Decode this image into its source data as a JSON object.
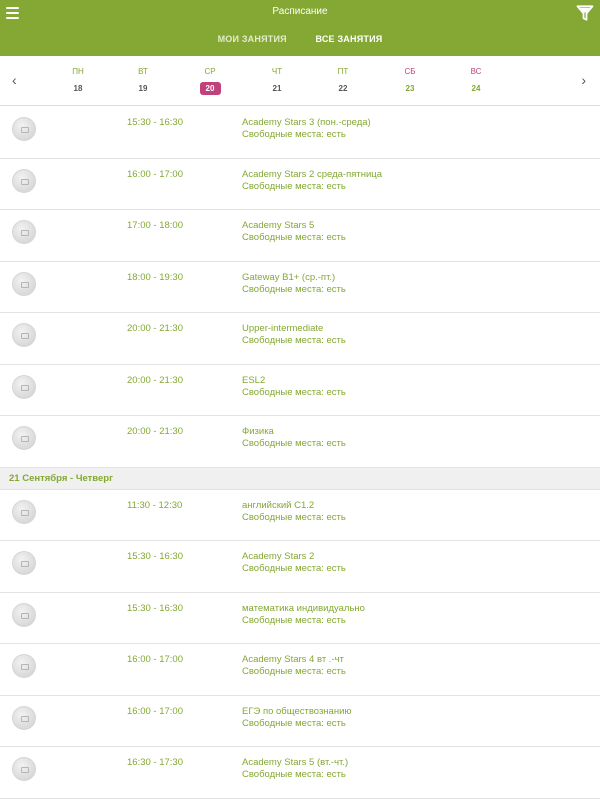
{
  "header": {
    "title": "Расписание",
    "tabs": [
      {
        "label": "МОИ ЗАНЯТИЯ",
        "active": false
      },
      {
        "label": "ВСЕ ЗАНЯТИЯ",
        "active": true
      }
    ],
    "menu_icon": "hamburger-icon",
    "filter_icon": "filter-icon"
  },
  "colors": {
    "accent": "#84a833",
    "highlight": "#c0427c"
  },
  "week": {
    "prev_icon": "chevron-left-icon",
    "next_icon": "chevron-right-icon",
    "days": [
      {
        "name": "ПН",
        "num": "18"
      },
      {
        "name": "ВТ",
        "num": "19"
      },
      {
        "name": "СР",
        "num": "20"
      },
      {
        "name": "ЧТ",
        "num": "21"
      },
      {
        "name": "ПТ",
        "num": "22"
      },
      {
        "name": "СБ",
        "num": "23"
      },
      {
        "name": "ВС",
        "num": "24"
      }
    ],
    "selected_day": "20"
  },
  "schedule": {
    "day_header": "21 Сентября - Четверг",
    "seats_label": "Свободные места: есть",
    "rows": [
      {
        "time": "15:30 - 16:30",
        "name": "Academy Stars 3 (пон.-среда)",
        "seats": "Свободные места: есть"
      },
      {
        "time": "16:00 - 17:00",
        "name": "Academy Stars 2 среда-пятница",
        "seats": "Свободные места: есть"
      },
      {
        "time": "17:00 - 18:00",
        "name": "Academy Stars 5",
        "seats": "Свободные места: есть"
      },
      {
        "time": "18:00 - 19:30",
        "name": "Gateway B1+ (ср.-пт.)",
        "seats": "Свободные места: есть"
      },
      {
        "time": "20:00 - 21:30",
        "name": "Upper-intermediate",
        "seats": "Свободные места: есть"
      },
      {
        "time": "20:00 - 21:30",
        "name": "ESL2",
        "seats": "Свободные места: есть"
      },
      {
        "time": "20:00 - 21:30",
        "name": "Физика",
        "seats": "Свободные места: есть"
      },
      {
        "time": "11:30 - 12:30",
        "name": "английский C1.2",
        "seats": "Свободные места: есть"
      },
      {
        "time": "15:30 - 16:30",
        "name": "Academy Stars 2",
        "seats": "Свободные места: есть"
      },
      {
        "time": "15:30 - 16:30",
        "name": "математика индивидуально",
        "seats": "Свободные места: есть"
      },
      {
        "time": "16:00 - 17:00",
        "name": "Academy Stars 4 вт .-чт",
        "seats": "Свободные места: есть"
      },
      {
        "time": "16:00 - 17:00",
        "name": "ЕГЭ по обществознанию",
        "seats": "Свободные места: есть"
      },
      {
        "time": "16:30 - 17:30",
        "name": "Academy Stars 5 (вт.-чт.)",
        "seats": "Свободные места: есть"
      }
    ]
  }
}
